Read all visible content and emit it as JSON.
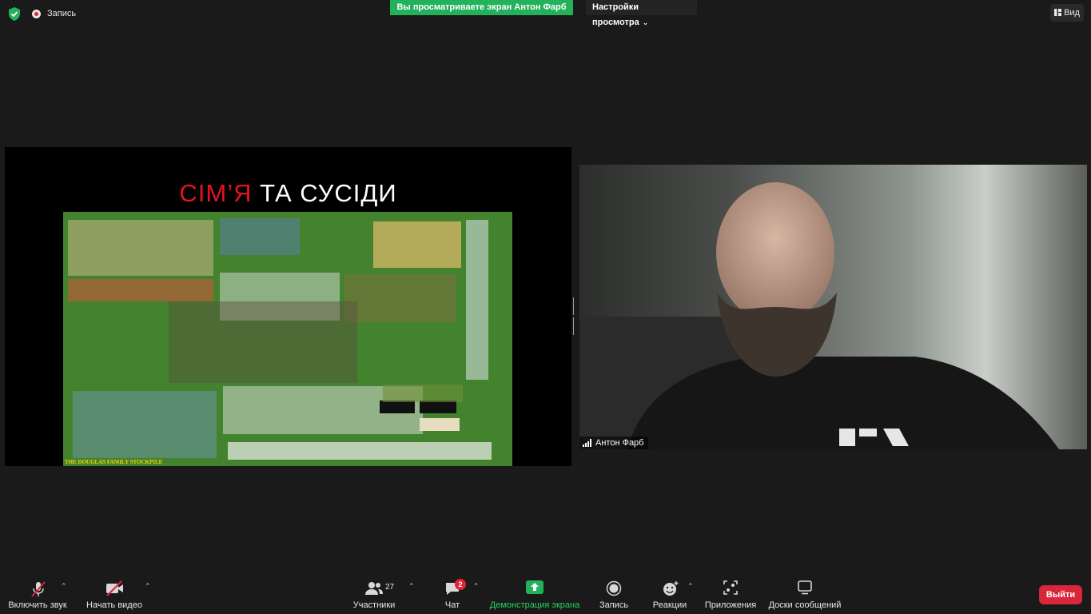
{
  "top_bar": {
    "recording_label": "Запись",
    "share_banner": "Вы просматриваете экран Антон Фарб",
    "view_settings": "Настройки просмотра",
    "view_button": "Вид"
  },
  "slide": {
    "title_red": "СІМ’Я",
    "title_white": " ТА СУСІДИ",
    "photo_caption": "THE DOUGLAS FAMILY STOCKPILE"
  },
  "participant": {
    "name": "Антон Фарб"
  },
  "toolbar": {
    "unmute": "Включить звук",
    "start_video": "Начать видео",
    "participants": "Участники",
    "participants_count": "27",
    "chat": "Чат",
    "chat_badge": "2",
    "share_screen": "Демонстрация экрана",
    "record": "Запись",
    "reactions": "Реакции",
    "apps": "Приложения",
    "whiteboards": "Доски сообщений",
    "leave": "Выйти"
  },
  "colors": {
    "background": "#1a1a1a",
    "banner_green": "#23b15b",
    "share_green": "#23d160",
    "leave_red": "#d9263a",
    "slide_red": "#e3141e"
  }
}
